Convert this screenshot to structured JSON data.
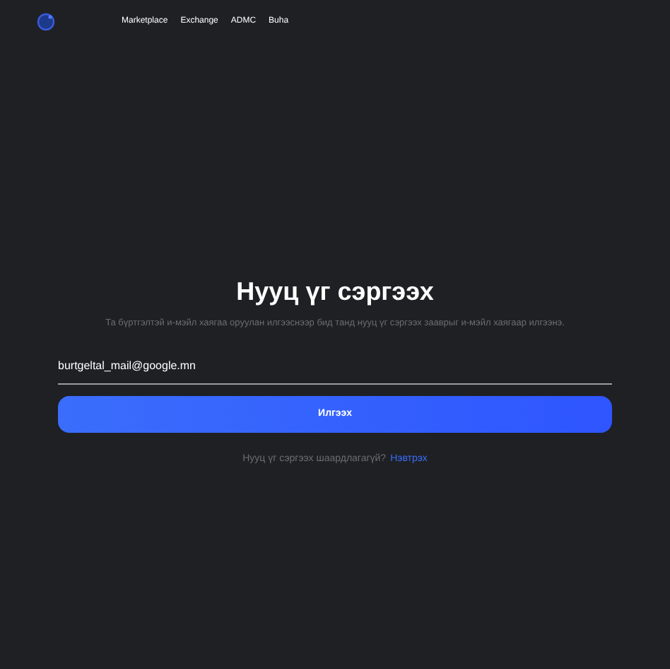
{
  "nav": {
    "links": [
      "Marketplace",
      "Exchange",
      "ADMC",
      "Buha"
    ]
  },
  "form": {
    "title": "Нууц үг сэргээх",
    "description": "Та бүртгэлтэй и-мэйл хаягаа оруулан илгээснээр бид танд нууц үг сэргээх зааврыг и-мэйл хаягаар илгээнэ.",
    "email": "burtgeltal_mail@google.mn",
    "submit": "Илгээх",
    "footer_text": "Нууц үг сэргээх шаардлагагүй?",
    "footer_link": "Нэвтрэх"
  }
}
